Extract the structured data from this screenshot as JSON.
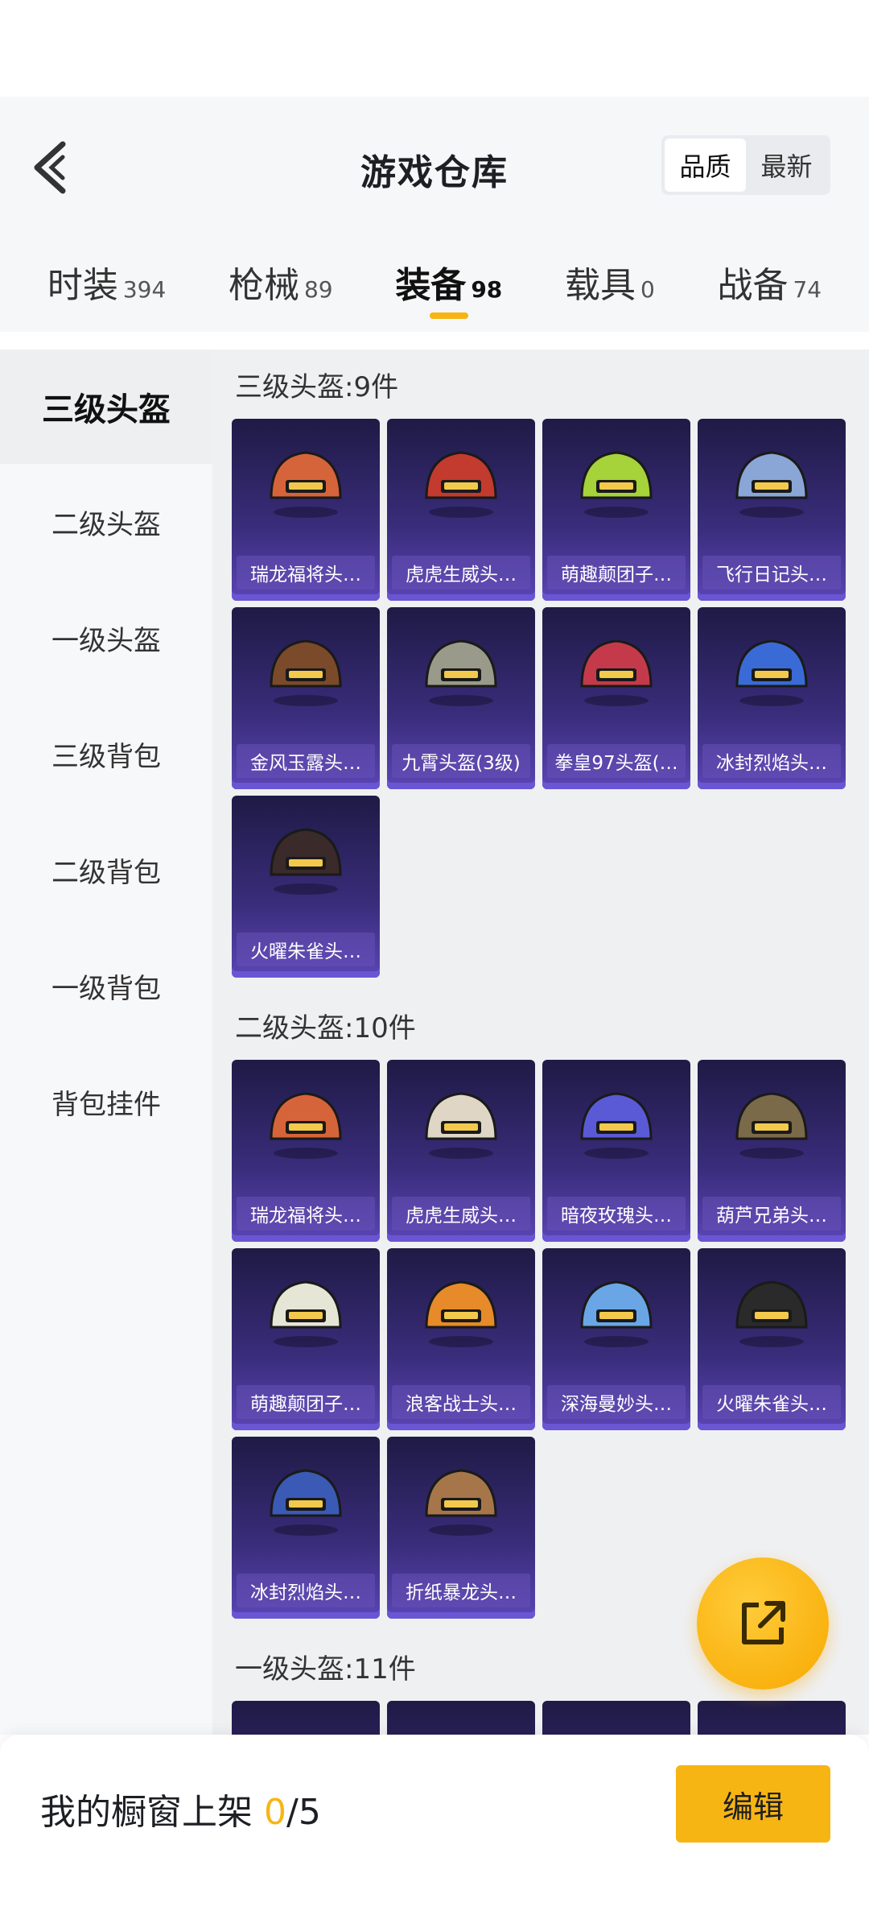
{
  "header": {
    "title": "游戏仓库",
    "sort": [
      "品质",
      "最新"
    ],
    "sort_active": "品质"
  },
  "tabs": [
    {
      "label": "时装",
      "count": "394"
    },
    {
      "label": "枪械",
      "count": "89"
    },
    {
      "label": "装备",
      "count": "98"
    },
    {
      "label": "载具",
      "count": "0"
    },
    {
      "label": "战备",
      "count": "74"
    }
  ],
  "sidebar": [
    "三级头盔",
    "二级头盔",
    "一级头盔",
    "三级背包",
    "二级背包",
    "一级背包",
    "背包挂件"
  ],
  "sections": [
    {
      "title": "三级头盔:9件",
      "items": [
        "瑞龙福将头…",
        "虎虎生威头…",
        "萌趣颠团子…",
        "飞行日记头…",
        "金风玉露头…",
        "九霄头盔(3级)",
        "拳皇97头盔(…",
        "冰封烈焰头…",
        "火曜朱雀头…"
      ]
    },
    {
      "title": "二级头盔:10件",
      "items": [
        "瑞龙福将头…",
        "虎虎生威头…",
        "暗夜玫瑰头…",
        "葫芦兄弟头…",
        "萌趣颠团子…",
        "浪客战士头…",
        "深海曼妙头…",
        "火曜朱雀头…",
        "冰封烈焰头…",
        "折纸暴龙头…"
      ]
    },
    {
      "title": "一级头盔:11件",
      "items": [
        "",
        "",
        "",
        ""
      ]
    }
  ],
  "bottom": {
    "shelf_prefix": "我的橱窗上架",
    "shelf_current": "0",
    "shelf_total": "/5",
    "edit_label": "编辑"
  },
  "colors": {
    "accent": "#f7b514",
    "card": "#3a2d7c"
  }
}
